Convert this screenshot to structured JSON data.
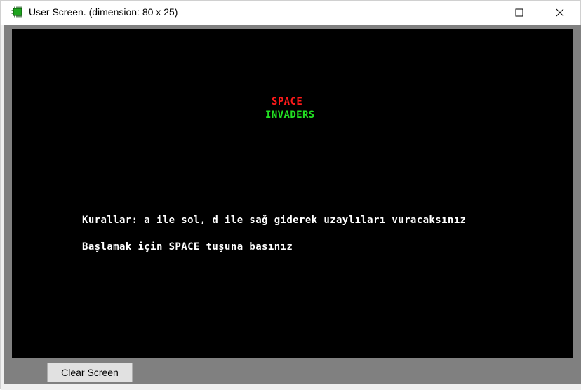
{
  "window": {
    "title": "User Screen. (dimension: 80 x 25)",
    "controls": {
      "minimize_icon": "minimize-icon",
      "maximize_icon": "maximize-icon",
      "close_icon": "close-icon"
    }
  },
  "screen": {
    "background": "#000000",
    "title_line1": "SPACE",
    "title_line2": "INVADERS",
    "rules_text": "Kurallar: a ile sol, d ile sağ giderek uzaylıları vuracaksınız",
    "start_text": "Başlamak için SPACE tuşuna basınız",
    "colors": {
      "title_line1": "#ff1a1a",
      "title_line2": "#22e022",
      "body_text": "#ffffff"
    }
  },
  "footer": {
    "clear_button_label": "Clear Screen"
  }
}
